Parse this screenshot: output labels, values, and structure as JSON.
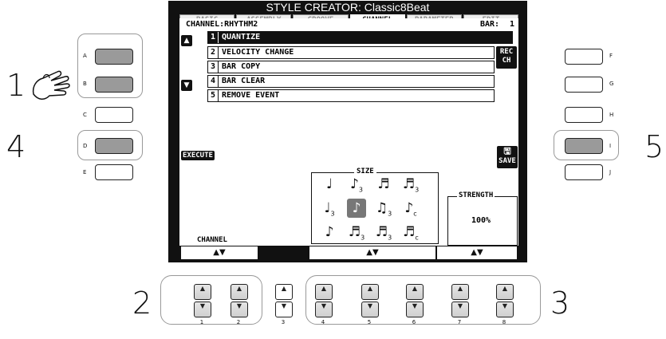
{
  "screen": {
    "title": "STYLE CREATOR: Classic8Beat",
    "tabs": [
      "BASIC",
      "ASSEMBLY",
      "GROOVE",
      "CHANNEL",
      "PARAMETER",
      "EDIT"
    ],
    "active_tab": "CHANNEL",
    "channel_label": "CHANNEL:RHYTHM2",
    "bar_label": "BAR:",
    "bar_value": "1",
    "menu": [
      {
        "num": "1",
        "label": "QUANTIZE"
      },
      {
        "num": "2",
        "label": "VELOCITY CHANGE"
      },
      {
        "num": "3",
        "label": "BAR COPY"
      },
      {
        "num": "4",
        "label": "BAR CLEAR"
      },
      {
        "num": "5",
        "label": "REMOVE EVENT"
      }
    ],
    "rec_ch": [
      "REC",
      "CH"
    ],
    "execute_label": "EXECUTE",
    "save_label": "SAVE",
    "size_label": "SIZE",
    "strength_label": "STRENGTH",
    "strength_value": "100%",
    "channel_footer": "CHANNEL",
    "up_down": "▲▼"
  },
  "buttons_left": [
    "A",
    "B",
    "C",
    "D",
    "E"
  ],
  "buttons_right": [
    "F",
    "G",
    "H",
    "I",
    "J"
  ],
  "bottom_buttons": [
    "1",
    "2",
    "3",
    "4",
    "5",
    "6",
    "7",
    "8"
  ],
  "steps": [
    "1",
    "2",
    "3",
    "4",
    "5"
  ]
}
